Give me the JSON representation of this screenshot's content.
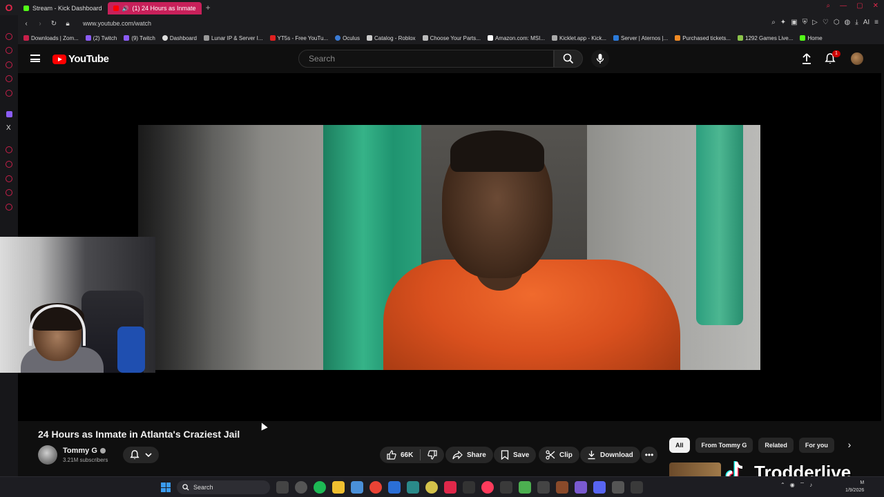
{
  "browser": {
    "tabs": [
      {
        "label": "Stream - Kick Dashboard",
        "active": false
      },
      {
        "label": "(1) 24 Hours as Inmate",
        "active": true
      }
    ],
    "url": "www.youtube.com/watch",
    "bookmarks": [
      "Downloads | Zom...",
      "(2) Twitch",
      "(9) Twitch",
      "Dashboard",
      "Lunar IP & Server I...",
      "YT5s - Free YouTu...",
      "Oculus",
      "Catalog - Roblox",
      "Choose Your Parts...",
      "Amazon.com: MSI...",
      "Kicklet.app - Kick...",
      "Server | Aternos |...",
      "Purchased tickets...",
      "1292 Games Live...",
      "Home"
    ],
    "ai_label": "AI"
  },
  "youtube": {
    "logo_text": "YouTube",
    "search_placeholder": "Search",
    "notification_count": "1"
  },
  "video": {
    "title": "24 Hours as Inmate in Atlanta's Craziest Jail",
    "channel_name": "Tommy G",
    "subscribers": "3.21M subscribers",
    "likes": "66K",
    "actions": {
      "share": "Share",
      "save": "Save",
      "clip": "Clip",
      "download": "Download"
    }
  },
  "recommendations": {
    "chips": [
      "All",
      "From Tommy G",
      "Related",
      "For you"
    ]
  },
  "overlay": {
    "brand": "Trodderlive"
  },
  "taskbar": {
    "search_label": "Search",
    "time": "M",
    "date": "1/9/2026"
  },
  "colors": {
    "accent_tab": "#c8205a",
    "youtube_red": "#ff0000",
    "background": "#0f0f0f"
  }
}
